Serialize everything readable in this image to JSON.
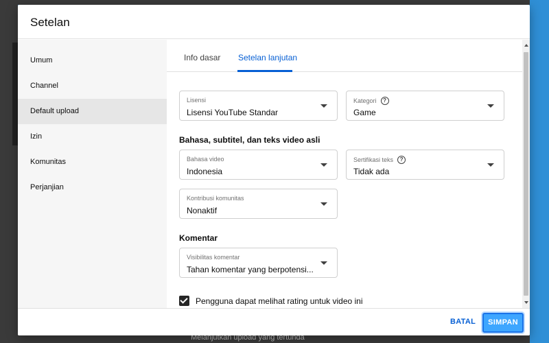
{
  "dialog": {
    "title": "Setelan"
  },
  "sidebar": {
    "items": [
      {
        "label": "Umum",
        "active": false
      },
      {
        "label": "Channel",
        "active": false
      },
      {
        "label": "Default upload",
        "active": true
      },
      {
        "label": "Izin",
        "active": false
      },
      {
        "label": "Komunitas",
        "active": false
      },
      {
        "label": "Perjanjian",
        "active": false
      }
    ]
  },
  "tabs": [
    {
      "label": "Info dasar",
      "active": false
    },
    {
      "label": "Setelan lanjutan",
      "active": true
    }
  ],
  "fields": {
    "license": {
      "label": "Lisensi",
      "value": "Lisensi YouTube Standar"
    },
    "category": {
      "label": "Kategori",
      "value": "Game"
    },
    "video_language": {
      "label": "Bahasa video",
      "value": "Indonesia"
    },
    "caption_cert": {
      "label": "Sertifikasi teks",
      "value": "Tidak ada"
    },
    "community_contrib": {
      "label": "Kontribusi komunitas",
      "value": "Nonaktif"
    },
    "comment_visibility": {
      "label": "Visibilitas komentar",
      "value": "Tahan komentar yang berpotensi..."
    }
  },
  "sections": {
    "language": "Bahasa, subtitel, dan teks video asli",
    "comments": "Komentar"
  },
  "checkbox": {
    "label": "Pengguna dapat melihat rating untuk video ini",
    "checked": true
  },
  "footer": {
    "cancel_label": "BATAL",
    "save_label": "SIMPAN"
  },
  "background": {
    "bottom_fragment": "Melanjutkan upload yang tertunda"
  },
  "colors": {
    "accent": "#065fd4",
    "save_button": "#3ea6ff",
    "page_bg": "#2f8fd6"
  }
}
